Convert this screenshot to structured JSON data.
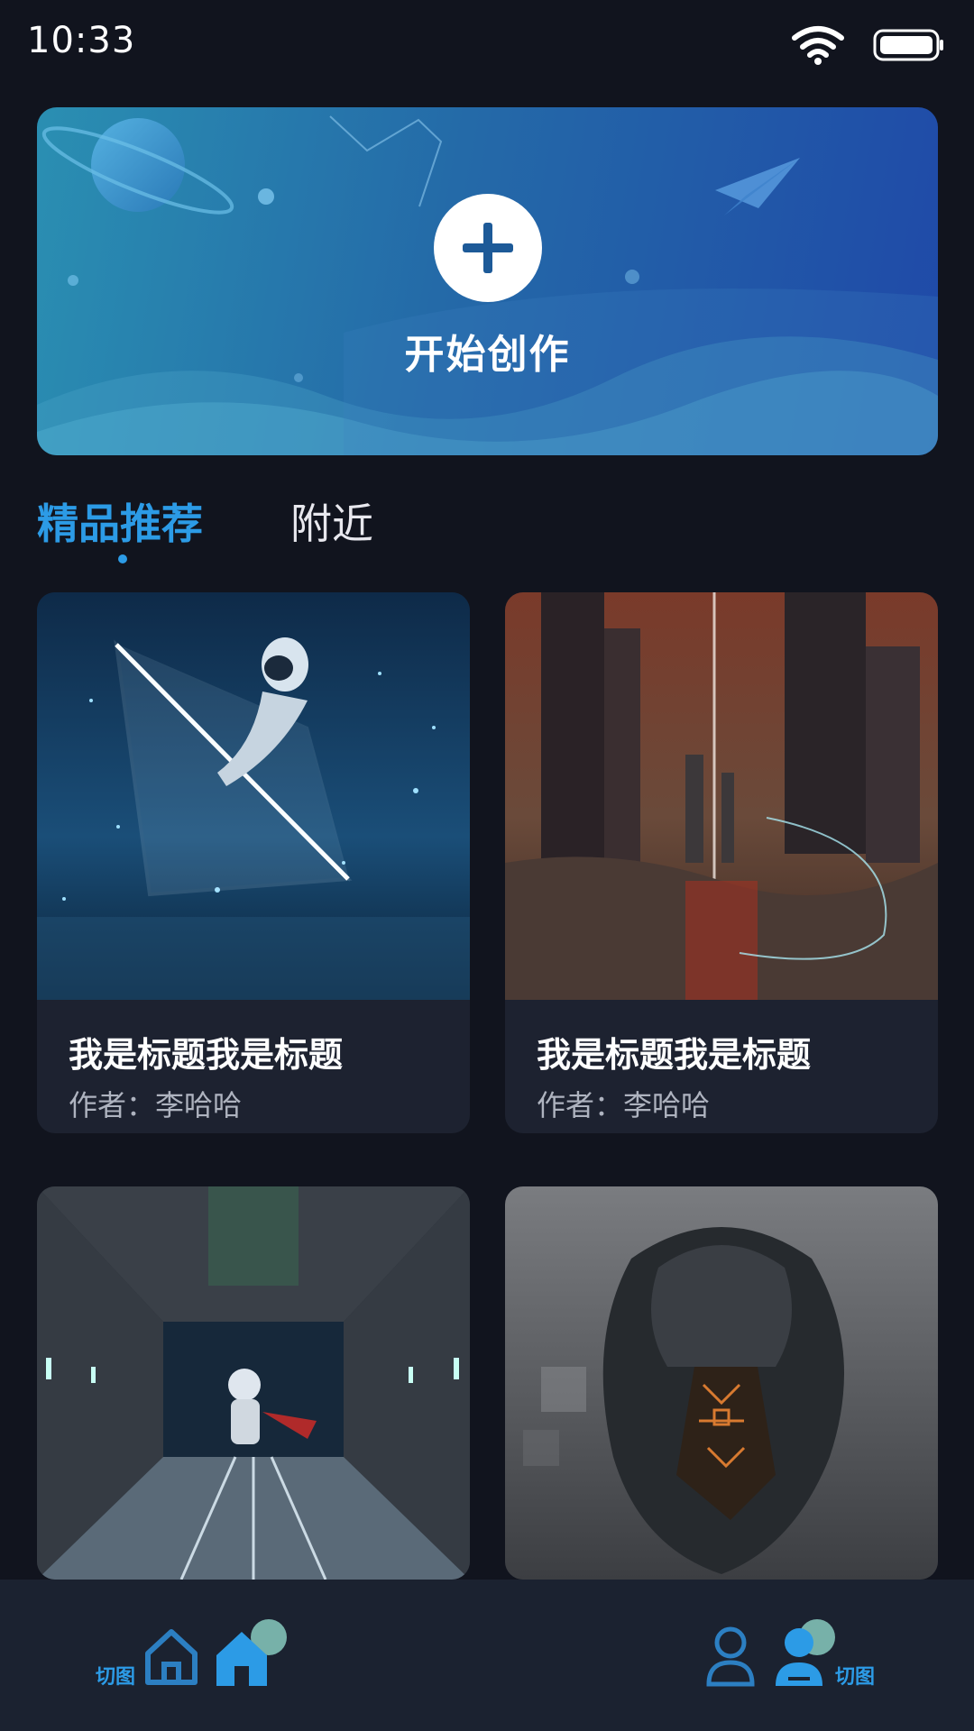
{
  "status_bar": {
    "time": "10:33"
  },
  "banner": {
    "label": "开始创作",
    "icon": "plus-icon"
  },
  "tabs": [
    {
      "label": "精品推荐",
      "active": true
    },
    {
      "label": "附近",
      "active": false
    }
  ],
  "cards": [
    {
      "title": "我是标题我是标题",
      "author": "作者：李哈哈",
      "image": "astronaut-glass-prism"
    },
    {
      "title": "我是标题我是标题",
      "author": "作者：李哈哈",
      "image": "sci-fi-city-red-lake"
    },
    {
      "title": "",
      "author": "",
      "image": "astronaut-corridor"
    },
    {
      "title": "",
      "author": "",
      "image": "robot-head"
    }
  ],
  "bottom_nav": {
    "left_label": "切图",
    "right_label": "切图",
    "icons": [
      "home-outline-icon",
      "home-filled-icon",
      "user-outline-icon",
      "user-filled-icon"
    ]
  },
  "colors": {
    "accent": "#2c9be6",
    "background": "#11141e",
    "card_bg": "#1d2230",
    "nav_bg": "#1b2230"
  }
}
